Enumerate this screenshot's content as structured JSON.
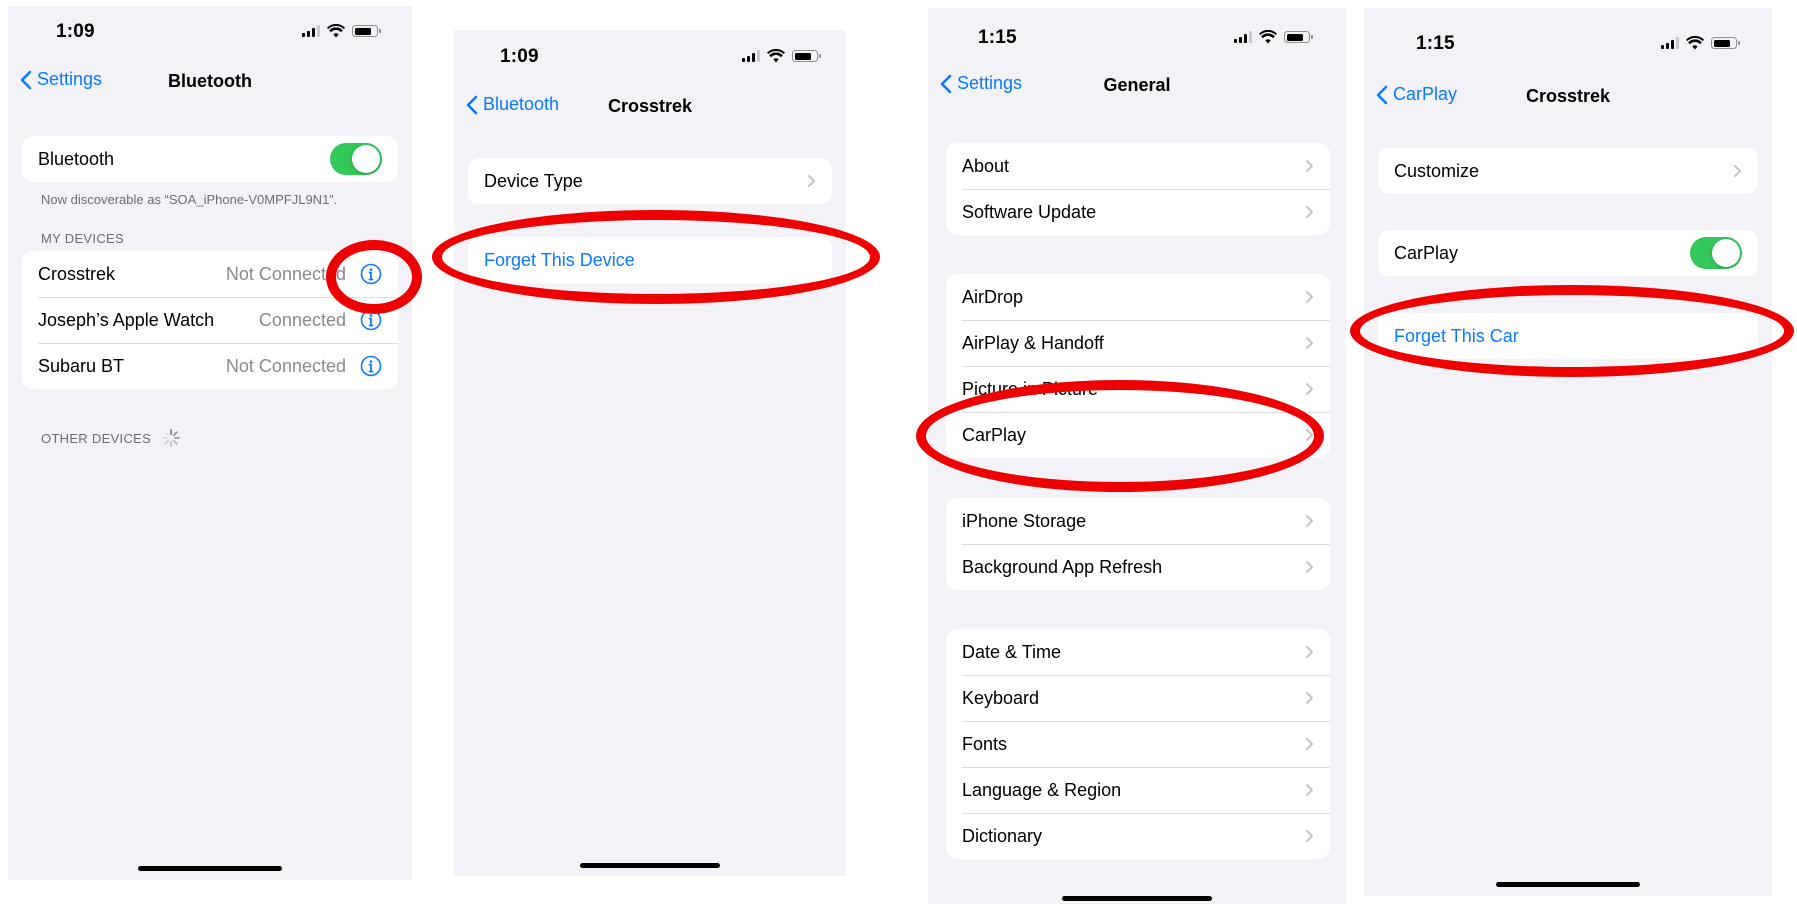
{
  "screen1": {
    "time": "1:09",
    "back_label": "Settings",
    "title": "Bluetooth",
    "bluetooth_label": "Bluetooth",
    "discoverable_caption": "Now discoverable as “SOA_iPhone-V0MPFJL9N1”.",
    "my_devices_header": "MY DEVICES",
    "devices": [
      {
        "name": "Crosstrek",
        "status": "Not Connected"
      },
      {
        "name": "Joseph’s Apple Watch",
        "status": "Connected"
      },
      {
        "name": "Subaru BT",
        "status": "Not Connected"
      }
    ],
    "other_devices_header": "OTHER DEVICES"
  },
  "screen2": {
    "time": "1:09",
    "back_label": "Bluetooth",
    "title": "Crosstrek",
    "device_type_label": "Device Type",
    "forget_label": "Forget This Device"
  },
  "screen3": {
    "time": "1:15",
    "back_label": "Settings",
    "title": "General",
    "groups": [
      [
        "About",
        "Software Update"
      ],
      [
        "AirDrop",
        "AirPlay & Handoff",
        "Picture in Picture",
        "CarPlay"
      ],
      [
        "iPhone Storage",
        "Background App Refresh"
      ],
      [
        "Date & Time",
        "Keyboard",
        "Fonts",
        "Language & Region",
        "Dictionary"
      ]
    ]
  },
  "screen4": {
    "time": "1:15",
    "back_label": "CarPlay",
    "title": "Crosstrek",
    "customize_label": "Customize",
    "carplay_label": "CarPlay",
    "forget_label": "Forget This Car"
  },
  "colors": {
    "accent": "#0a7aff",
    "toggle_on": "#34c759",
    "annotation": "#ee0000",
    "background": "#f2f2f7"
  },
  "icons": {
    "back": "chevron-left-icon",
    "disclosure": "chevron-right-icon",
    "info": "info-circle-icon",
    "signal": "cellular-signal-icon",
    "wifi": "wifi-icon",
    "battery": "battery-icon",
    "spinner": "activity-spinner-icon"
  }
}
